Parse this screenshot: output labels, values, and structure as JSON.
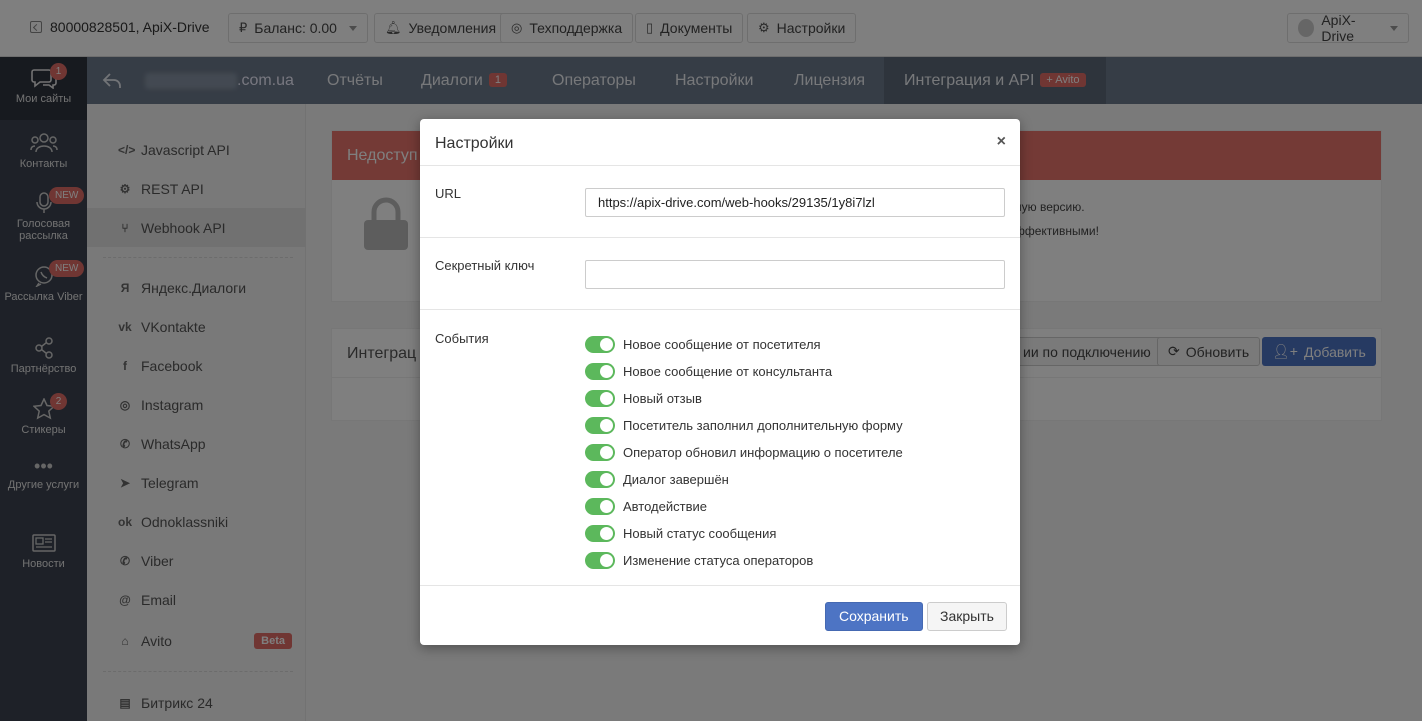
{
  "topbar": {
    "site": "80000828501, ApiX-Drive",
    "balance": "Баланс: 0.00",
    "notifications": "Уведомления",
    "support": "Техподдержка",
    "documents": "Документы",
    "settings": "Настройки",
    "user": "ApiX-Drive"
  },
  "leftnav": {
    "items": [
      {
        "label": "Мои сайты",
        "badge": "1",
        "icon": "chat-icon"
      },
      {
        "label": "Контакты",
        "icon": "users-icon"
      },
      {
        "label": "Голосовая рассылка",
        "badge": "NEW",
        "icon": "microphone-icon"
      },
      {
        "label": "Рассылка Viber",
        "badge": "NEW",
        "icon": "viber-icon"
      },
      {
        "label": "Партнёрство",
        "icon": "share-icon"
      },
      {
        "label": "Стикеры",
        "badge": "2",
        "icon": "star-icon"
      },
      {
        "label": "Другие услуги",
        "icon": "more-icon"
      },
      {
        "label": "Новости",
        "icon": "newspaper-icon"
      }
    ]
  },
  "topmenu": {
    "site_suffix": ".com.ua",
    "reports": "Отчёты",
    "dialogs": "Диалоги",
    "dialogs_badge": "1",
    "operators": "Операторы",
    "settings": "Настройки",
    "license": "Лицензия",
    "integration": "Интеграция и API",
    "integration_badge": "+ Avito"
  },
  "subnav": {
    "items": [
      {
        "label": "Javascript API",
        "icon": "</>"
      },
      {
        "label": "REST API",
        "icon": "⚙"
      },
      {
        "label": "Webhook API",
        "icon": "⑂"
      },
      {
        "label": "Яндекс.Диалоги",
        "icon": "Я"
      },
      {
        "label": "VKontakte",
        "icon": "vk"
      },
      {
        "label": "Facebook",
        "icon": "f"
      },
      {
        "label": "Instagram",
        "icon": "◎"
      },
      {
        "label": "WhatsApp",
        "icon": "✆"
      },
      {
        "label": "Telegram",
        "icon": "➤"
      },
      {
        "label": "Odnoklassniki",
        "icon": "ok"
      },
      {
        "label": "Viber",
        "icon": "✆"
      },
      {
        "label": "Email",
        "icon": "@"
      },
      {
        "label": "Avito",
        "icon": "⌂",
        "badge": "Beta"
      },
      {
        "label": "Битрикс 24",
        "icon": "▤"
      }
    ]
  },
  "background": {
    "alert_title": "Недоступ",
    "alert_line1": "ную версию.",
    "alert_line2": "ффективными!",
    "integr_title": "Интеграц",
    "instr_btn": "ии по подключению",
    "refresh_btn": "Обновить",
    "add_btn": "Добавить"
  },
  "modal": {
    "title": "Настройки",
    "close": "×",
    "url_label": "URL",
    "url_value": "https://apix-drive.com/web-hooks/29135/1y8i7lzl",
    "secret_label": "Секретный ключ",
    "secret_value": "",
    "events_label": "События",
    "events": [
      "Новое сообщение от посетителя",
      "Новое сообщение от консультанта",
      "Новый отзыв",
      "Посетитель заполнил дополнительную форму",
      "Оператор обновил информацию о посетителе",
      "Диалог завершён",
      "Автодействие",
      "Новый статус сообщения",
      "Изменение статуса операторов"
    ],
    "save": "Сохранить",
    "cancel": "Закрыть"
  },
  "colors": {
    "accent": "#4d74c4",
    "toggle_on": "#5cb85c",
    "badge": "#e06c66",
    "sidebar": "#3c4350",
    "topmenu": "#6d7a8c"
  }
}
